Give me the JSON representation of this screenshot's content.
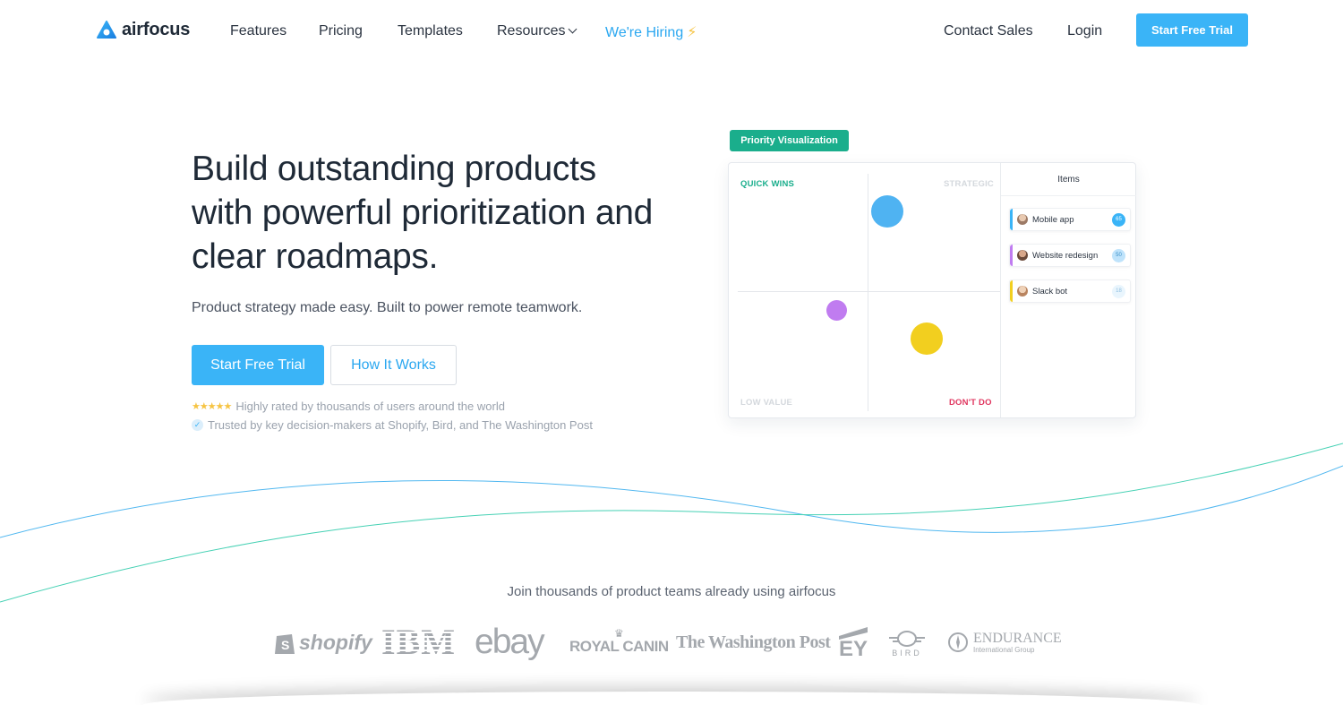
{
  "nav": {
    "brand": "airfocus",
    "items": [
      "Features",
      "Pricing",
      "Templates",
      "Resources"
    ],
    "hiring": "We're Hiring",
    "contact": "Contact Sales",
    "login": "Login",
    "cta": "Start Free Trial"
  },
  "hero": {
    "title": "Build outstanding products with powerful prioritization and clear roadmaps.",
    "subtitle": "Product strategy made easy. Built to power remote teamwork.",
    "primary_button": "Start Free Trial",
    "secondary_button": "How It Works",
    "stars": "★★★★★",
    "rating_text": "Highly rated by thousands of users around the world",
    "trusted_text": "Trusted by key decision-makers at Shopify, Bird, and The Washington Post"
  },
  "priority_card": {
    "badge": "Priority Visualization",
    "quadrants": {
      "quick_wins": "QUICK WINS",
      "strategic": "STRATEGIC",
      "low_value": "LOW VALUE",
      "dont_do": "DON'T DO"
    },
    "items_header": "Items",
    "items": [
      {
        "name": "Mobile app",
        "score": "65",
        "color": "#3ab4f7"
      },
      {
        "name": "Website redesign",
        "score": "50",
        "color": "#c07cf0"
      },
      {
        "name": "Slack bot",
        "score": "18",
        "color": "#f2cf1f"
      }
    ]
  },
  "customers": {
    "heading": "Join thousands of product teams already using airfocus",
    "logos": [
      "shopify",
      "IBM",
      "ebay",
      "ROYAL CANIN",
      "The Washington Post",
      "EY",
      "BIRD",
      "ENDURANCE",
      "International Group"
    ]
  },
  "colors": {
    "accent": "#3ab4f7",
    "green": "#1aae8c",
    "red": "#e0365f",
    "purple": "#c07cf0",
    "yellow": "#f2cf1f"
  }
}
